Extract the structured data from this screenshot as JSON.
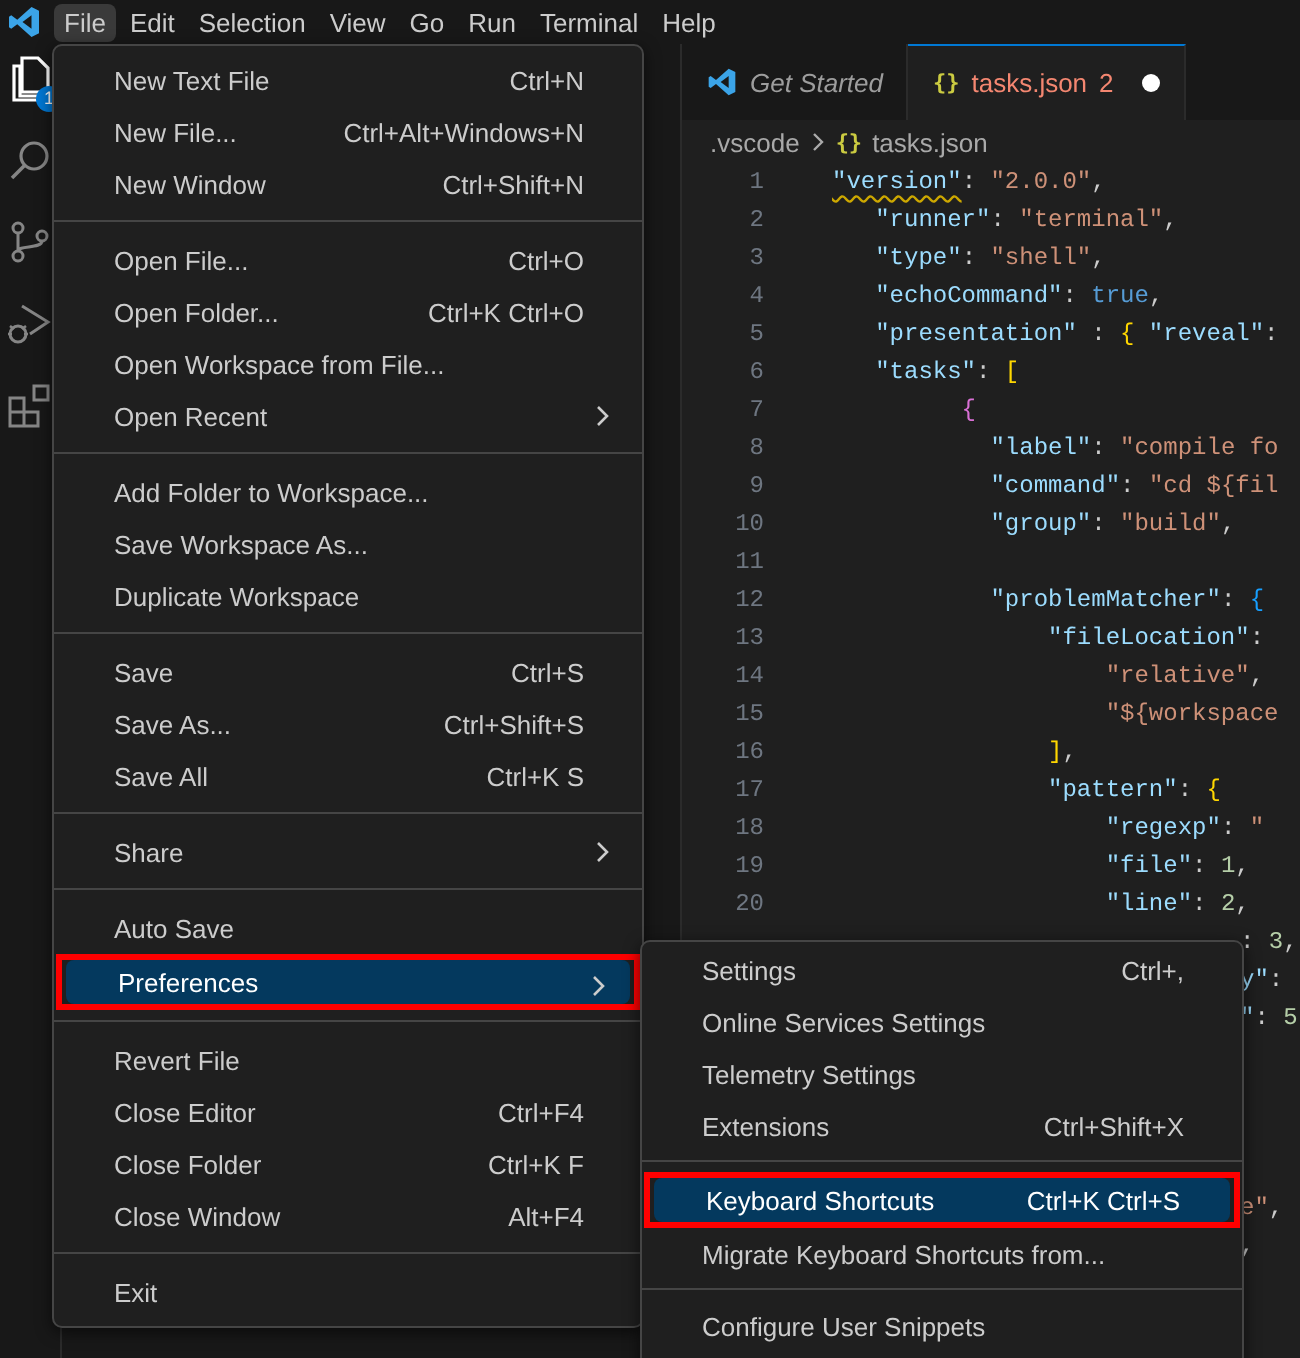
{
  "menubar": [
    {
      "label": "File",
      "selected": true
    },
    {
      "label": "Edit",
      "selected": false
    },
    {
      "label": "Selection",
      "selected": false
    },
    {
      "label": "View",
      "selected": false
    },
    {
      "label": "Go",
      "selected": false
    },
    {
      "label": "Run",
      "selected": false
    },
    {
      "label": "Terminal",
      "selected": false
    },
    {
      "label": "Help",
      "selected": false
    }
  ],
  "activity_bar": [
    {
      "kind": "files",
      "badge": "1"
    },
    {
      "kind": "search"
    },
    {
      "kind": "scm"
    },
    {
      "kind": "debug"
    },
    {
      "kind": "extensions"
    }
  ],
  "tabs": [
    {
      "label": "Get Started",
      "kind": "welcome",
      "preview": true,
      "selected": false
    },
    {
      "label": "tasks.json",
      "glyph": "{}",
      "kind": "json",
      "problems": "2",
      "modified": true,
      "selected": true
    }
  ],
  "breadcrumb": [
    {
      "label": ".vscode"
    },
    {
      "label": "tasks.json",
      "glyph": "{}"
    }
  ],
  "code": [
    {
      "number": "1",
      "tokens": [
        {
          "kind": "key",
          "t": "\"version\"",
          "warning": true
        },
        {
          "kind": "punc",
          "t": ": "
        },
        {
          "kind": "str",
          "t": "\"2.0.0\""
        },
        {
          "kind": "punc",
          "t": ","
        }
      ]
    },
    {
      "number": "2",
      "tokens": [
        {
          "kind": "key",
          "t": "   \"runner\""
        },
        {
          "kind": "punc",
          "t": ": "
        },
        {
          "kind": "str",
          "t": "\"terminal\""
        },
        {
          "kind": "punc",
          "t": ","
        }
      ]
    },
    {
      "number": "3",
      "tokens": [
        {
          "kind": "key",
          "t": "   \"type\""
        },
        {
          "kind": "punc",
          "t": ": "
        },
        {
          "kind": "str",
          "t": "\"shell\""
        },
        {
          "kind": "punc",
          "t": ","
        }
      ]
    },
    {
      "number": "4",
      "tokens": [
        {
          "kind": "key",
          "t": "   \"echoCommand\""
        },
        {
          "kind": "punc",
          "t": ": "
        },
        {
          "kind": "bool",
          "t": "true"
        },
        {
          "kind": "punc",
          "t": ","
        }
      ]
    },
    {
      "number": "5",
      "tokens": [
        {
          "kind": "key",
          "t": "   \"presentation\""
        },
        {
          "kind": "punc",
          "t": " : "
        },
        {
          "kind": "b1",
          "t": "{"
        },
        {
          "kind": "key",
          "t": " \"reveal\""
        },
        {
          "kind": "punc",
          "t": ":"
        }
      ]
    },
    {
      "number": "6",
      "tokens": [
        {
          "kind": "key",
          "t": "   \"tasks\""
        },
        {
          "kind": "punc",
          "t": ": "
        },
        {
          "kind": "b1",
          "t": "["
        }
      ]
    },
    {
      "number": "7",
      "tokens": [
        {
          "kind": "b2",
          "t": "         {"
        }
      ]
    },
    {
      "number": "8",
      "tokens": [
        {
          "kind": "key",
          "t": "           \"label\""
        },
        {
          "kind": "punc",
          "t": ": "
        },
        {
          "kind": "str",
          "t": "\"compile fo"
        }
      ]
    },
    {
      "number": "9",
      "tokens": [
        {
          "kind": "key",
          "t": "           \"command\""
        },
        {
          "kind": "punc",
          "t": ": "
        },
        {
          "kind": "str",
          "t": "\"cd ${fil"
        }
      ]
    },
    {
      "number": "10",
      "tokens": [
        {
          "kind": "key",
          "t": "           \"group\""
        },
        {
          "kind": "punc",
          "t": ": "
        },
        {
          "kind": "str",
          "t": "\"build\""
        },
        {
          "kind": "punc",
          "t": ","
        }
      ]
    },
    {
      "number": "11"
    },
    {
      "number": "12",
      "tokens": [
        {
          "kind": "key",
          "t": "           \"problemMatcher\""
        },
        {
          "kind": "punc",
          "t": ": "
        },
        {
          "kind": "b3",
          "t": "{"
        }
      ]
    },
    {
      "number": "13",
      "tokens": [
        {
          "kind": "key",
          "t": "               \"fileLocation\""
        },
        {
          "kind": "punc",
          "t": ":"
        }
      ]
    },
    {
      "number": "14",
      "tokens": [
        {
          "kind": "str",
          "t": "                   \"relative\""
        },
        {
          "kind": "punc",
          "t": ","
        }
      ]
    },
    {
      "number": "15",
      "tokens": [
        {
          "kind": "str",
          "t": "                   \"${workspace"
        }
      ]
    },
    {
      "number": "16",
      "tokens": [
        {
          "kind": "b1",
          "t": "               ]"
        },
        {
          "kind": "punc",
          "t": ","
        }
      ]
    },
    {
      "number": "17",
      "tokens": [
        {
          "kind": "key",
          "t": "               \"pattern\""
        },
        {
          "kind": "punc",
          "t": ": "
        },
        {
          "kind": "b1",
          "t": "{"
        }
      ]
    },
    {
      "number": "18",
      "tokens": [
        {
          "kind": "key",
          "t": "                   \"regexp\""
        },
        {
          "kind": "punc",
          "t": ": "
        },
        {
          "kind": "str",
          "t": "\""
        }
      ]
    },
    {
      "number": "19",
      "tokens": [
        {
          "kind": "key",
          "t": "                   \"file\""
        },
        {
          "kind": "punc",
          "t": ": "
        },
        {
          "kind": "num",
          "t": "1"
        },
        {
          "kind": "punc",
          "t": ","
        }
      ]
    },
    {
      "number": "20",
      "tokens": [
        {
          "kind": "key",
          "t": "                   \"line\""
        },
        {
          "kind": "punc",
          "t": ": "
        },
        {
          "kind": "num",
          "t": "2"
        },
        {
          "kind": "punc",
          "t": ","
        }
      ]
    }
  ],
  "code_tail_groups": [
    [
      [
        {
          "kind": "punc",
          "t": ": "
        },
        {
          "kind": "num",
          "t": "3"
        },
        {
          "kind": "punc",
          "t": ","
        }
      ],
      [
        {
          "kind": "key",
          "t": "y\""
        },
        {
          "kind": "punc",
          "t": ":"
        }
      ],
      [
        {
          "kind": "key",
          "t": "\""
        },
        {
          "kind": "punc",
          "t": ": "
        },
        {
          "kind": "num",
          "t": "5"
        }
      ]
    ],
    [
      [
        {
          "kind": "str",
          "t": "e\""
        },
        {
          "kind": "punc",
          "t": ","
        }
      ],
      [
        {
          "kind": "punc",
          "t": ","
        }
      ]
    ]
  ],
  "file_menu": {
    "groups": [
      {
        "items": [
          {
            "label": "New Text File",
            "shortcut": "Ctrl+N",
            "selected": false
          },
          {
            "label": "New File...",
            "shortcut": "Ctrl+Alt+Windows+N",
            "selected": false
          },
          {
            "label": "New Window",
            "shortcut": "Ctrl+Shift+N",
            "selected": false
          }
        ]
      },
      {
        "items": [
          {
            "label": "Open File...",
            "shortcut": "Ctrl+O",
            "selected": false
          },
          {
            "label": "Open Folder...",
            "shortcut": "Ctrl+K Ctrl+O",
            "selected": false
          },
          {
            "label": "Open Workspace from File...",
            "selected": false
          },
          {
            "label": "Open Recent",
            "has_submenu": true,
            "selected": false
          }
        ]
      },
      {
        "items": [
          {
            "label": "Add Folder to Workspace...",
            "selected": false
          },
          {
            "label": "Save Workspace As...",
            "selected": false
          },
          {
            "label": "Duplicate Workspace",
            "selected": false
          }
        ]
      },
      {
        "items": [
          {
            "label": "Save",
            "shortcut": "Ctrl+S",
            "selected": false
          },
          {
            "label": "Save As...",
            "shortcut": "Ctrl+Shift+S",
            "selected": false
          },
          {
            "label": "Save All",
            "shortcut": "Ctrl+K S",
            "selected": false
          }
        ]
      },
      {
        "items": [
          {
            "label": "Share",
            "has_submenu": true,
            "selected": false
          }
        ]
      },
      {
        "items": [
          {
            "label": "Auto Save",
            "selected": false
          },
          {
            "label": "Preferences",
            "has_submenu": true,
            "selected": true,
            "callout": true
          }
        ]
      },
      {
        "items": [
          {
            "label": "Revert File",
            "selected": false
          },
          {
            "label": "Close Editor",
            "shortcut": "Ctrl+F4",
            "selected": false
          },
          {
            "label": "Close Folder",
            "shortcut": "Ctrl+K F",
            "selected": false
          },
          {
            "label": "Close Window",
            "shortcut": "Alt+F4",
            "selected": false
          }
        ]
      },
      {
        "items": [
          {
            "label": "Exit",
            "selected": false
          }
        ]
      }
    ]
  },
  "preferences_submenu": {
    "groups": [
      {
        "items": [
          {
            "label": "Settings",
            "shortcut": "Ctrl+,",
            "selected": false
          },
          {
            "label": "Online Services Settings",
            "selected": false
          },
          {
            "label": "Telemetry Settings",
            "selected": false
          },
          {
            "label": "Extensions",
            "shortcut": "Ctrl+Shift+X",
            "selected": false
          }
        ]
      },
      {
        "items": [
          {
            "label": "Keyboard Shortcuts",
            "shortcut": "Ctrl+K Ctrl+S",
            "selected": true,
            "callout": true
          },
          {
            "label": "Migrate Keyboard Shortcuts from...",
            "selected": false
          }
        ]
      },
      {
        "items": [
          {
            "label": "Configure User Snippets",
            "selected": false
          }
        ]
      }
    ]
  }
}
